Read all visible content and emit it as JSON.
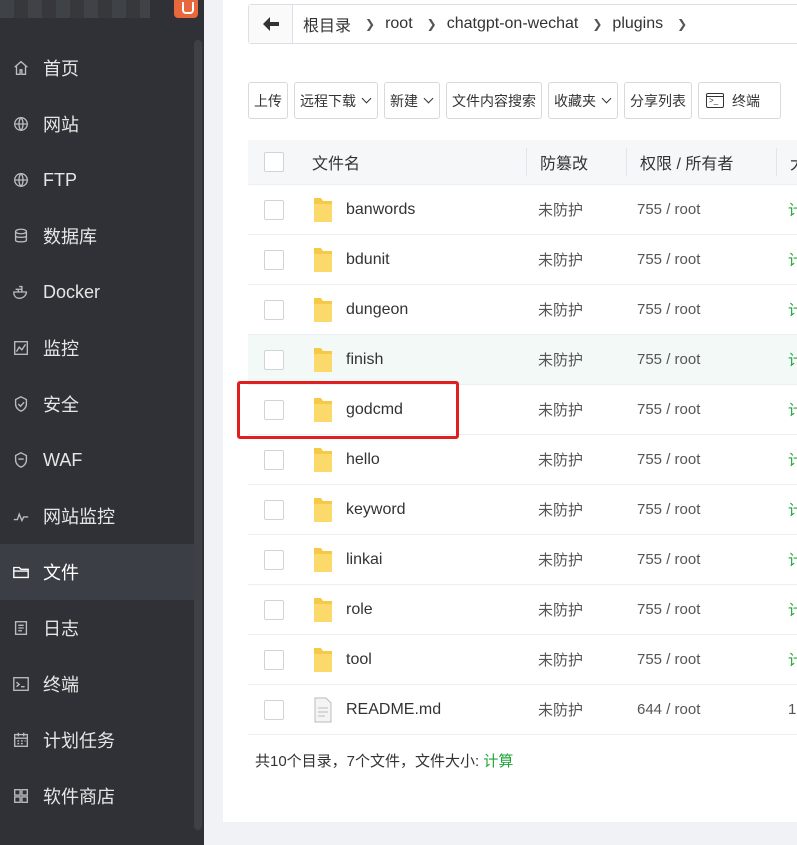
{
  "sidebar": {
    "items": [
      {
        "label": "首页",
        "icon": "home-icon"
      },
      {
        "label": "网站",
        "icon": "globe-icon"
      },
      {
        "label": "FTP",
        "icon": "ftp-globe-icon"
      },
      {
        "label": "数据库",
        "icon": "database-icon"
      },
      {
        "label": "Docker",
        "icon": "docker-icon"
      },
      {
        "label": "监控",
        "icon": "monitor-icon"
      },
      {
        "label": "安全",
        "icon": "shield-icon"
      },
      {
        "label": "WAF",
        "icon": "waf-shield-icon"
      },
      {
        "label": "网站监控",
        "icon": "pulse-icon"
      },
      {
        "label": "文件",
        "icon": "folder-icon",
        "active": true
      },
      {
        "label": "日志",
        "icon": "log-icon"
      },
      {
        "label": "终端",
        "icon": "terminal-icon"
      },
      {
        "label": "计划任务",
        "icon": "calendar-icon"
      },
      {
        "label": "软件商店",
        "icon": "apps-icon"
      }
    ]
  },
  "breadcrumb": {
    "items": [
      "根目录",
      "root",
      "chatgpt-on-wechat",
      "plugins"
    ]
  },
  "toolbar": {
    "upload": "上传",
    "remote_download": "远程下载",
    "new": "新建",
    "content_search": "文件内容搜索",
    "favorites": "收藏夹",
    "share_list": "分享列表",
    "terminal": "终端"
  },
  "table": {
    "headers": {
      "name": "文件名",
      "tamper": "防篡改",
      "perm": "权限 / 所有者",
      "size": "大"
    },
    "rows": [
      {
        "name": "banwords",
        "type": "folder",
        "tamper": "未防护",
        "perm": "755 / root",
        "size": "计"
      },
      {
        "name": "bdunit",
        "type": "folder",
        "tamper": "未防护",
        "perm": "755 / root",
        "size": "计"
      },
      {
        "name": "dungeon",
        "type": "folder",
        "tamper": "未防护",
        "perm": "755 / root",
        "size": "计"
      },
      {
        "name": "finish",
        "type": "folder",
        "tamper": "未防护",
        "perm": "755 / root",
        "size": "计"
      },
      {
        "name": "godcmd",
        "type": "folder",
        "tamper": "未防护",
        "perm": "755 / root",
        "size": "计"
      },
      {
        "name": "hello",
        "type": "folder",
        "tamper": "未防护",
        "perm": "755 / root",
        "size": "计"
      },
      {
        "name": "keyword",
        "type": "folder",
        "tamper": "未防护",
        "perm": "755 / root",
        "size": "计"
      },
      {
        "name": "linkai",
        "type": "folder",
        "tamper": "未防护",
        "perm": "755 / root",
        "size": "计"
      },
      {
        "name": "role",
        "type": "folder",
        "tamper": "未防护",
        "perm": "755 / root",
        "size": "计"
      },
      {
        "name": "tool",
        "type": "folder",
        "tamper": "未防护",
        "perm": "755 / root",
        "size": "计"
      },
      {
        "name": "README.md",
        "type": "file",
        "tamper": "未防护",
        "perm": "644 / root",
        "size": "1."
      }
    ]
  },
  "footer": {
    "summary": "共10个目录，7个文件，文件大小:",
    "calc_link": "计算"
  },
  "colors": {
    "sidebar_bg": "#2f3136",
    "accent_green": "#20a53a",
    "highlight_red": "#e02020"
  }
}
